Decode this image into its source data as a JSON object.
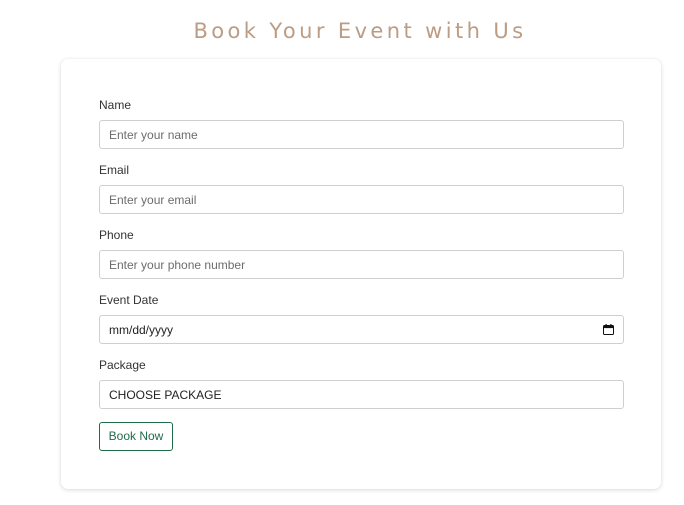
{
  "header": {
    "title": "Book Your Event with Us"
  },
  "form": {
    "name": {
      "label": "Name",
      "placeholder": "Enter your name"
    },
    "email": {
      "label": "Email",
      "placeholder": "Enter your email"
    },
    "phone": {
      "label": "Phone",
      "placeholder": "Enter your phone number"
    },
    "event_date": {
      "label": "Event Date",
      "value": "mm/dd/yyyy",
      "icon": "calendar-icon"
    },
    "package": {
      "label": "Package",
      "selected": "CHOOSE PACKAGE"
    },
    "submit_label": "Book Now"
  },
  "colors": {
    "title": "#bb9c84",
    "button_accent": "#1f6b4a",
    "input_border": "#cfcfcf"
  }
}
